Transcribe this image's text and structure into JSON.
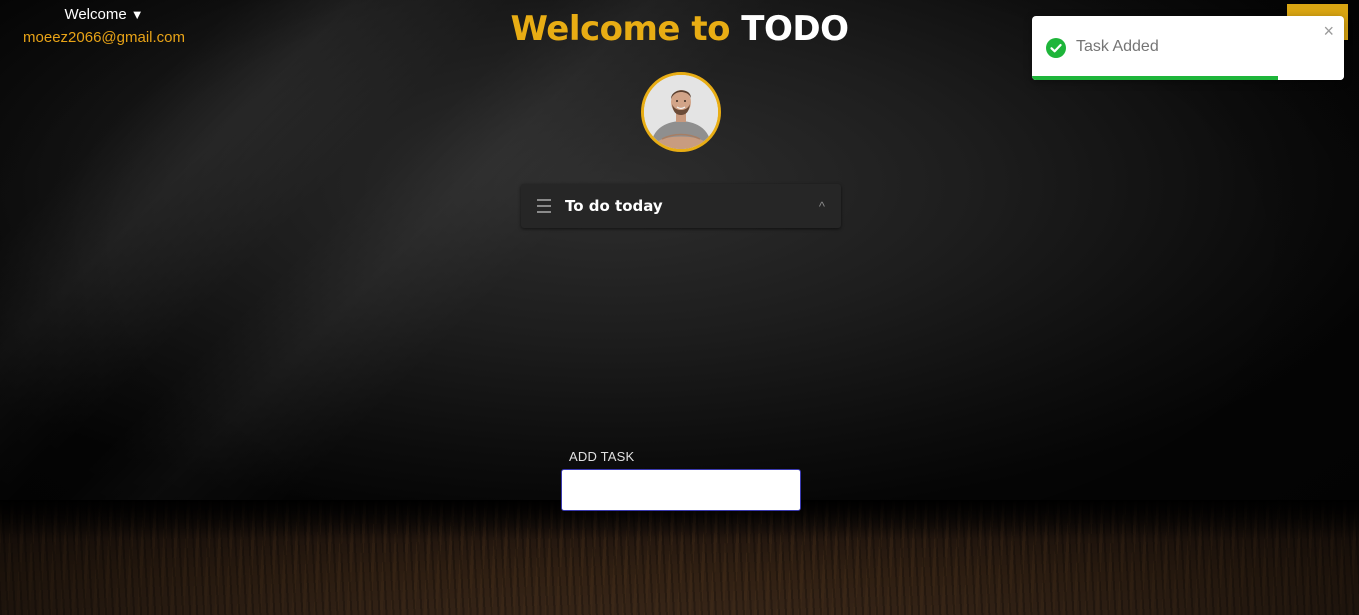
{
  "header": {
    "welcome_label": "Welcome",
    "email": "moeez2066@gmail.com",
    "title_accent": "Welcome to",
    "title_main": "TODO"
  },
  "avatar": {
    "icon": "user-photo"
  },
  "accordion": {
    "title": "To do today",
    "icon": "menu-icon",
    "chevron": "^",
    "expanded": true
  },
  "add_task": {
    "label": "ADD TASK",
    "value": ""
  },
  "toast": {
    "message": "Task Added",
    "close_glyph": "×",
    "status": "success",
    "progress": 0.79
  },
  "colors": {
    "accent": "#e8ad14",
    "email": "#e8a317",
    "success": "#1eb53a"
  }
}
